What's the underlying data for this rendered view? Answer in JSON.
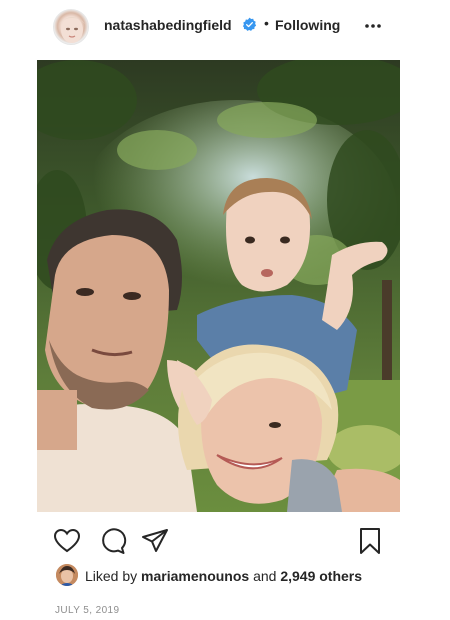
{
  "post": {
    "username": "natashabedingfield",
    "separator": "•",
    "follow_status": "Following",
    "more_icon": "more-horizontal-icon",
    "verified_color": "#3897f0"
  },
  "photo": {
    "alt_subject": "selfie-family-under-trees"
  },
  "actions": {
    "like_icon": "heart-icon",
    "comment_icon": "comment-icon",
    "share_icon": "paper-plane-icon",
    "save_icon": "bookmark-icon"
  },
  "likes": {
    "prefix": "Liked by",
    "user": "mariamenounos",
    "connector": "and",
    "others": "2,949 others"
  },
  "date": "JULY 5, 2019",
  "colors": {
    "text": "#262626",
    "muted": "#8e8e8e",
    "verified": "#3897f0"
  }
}
